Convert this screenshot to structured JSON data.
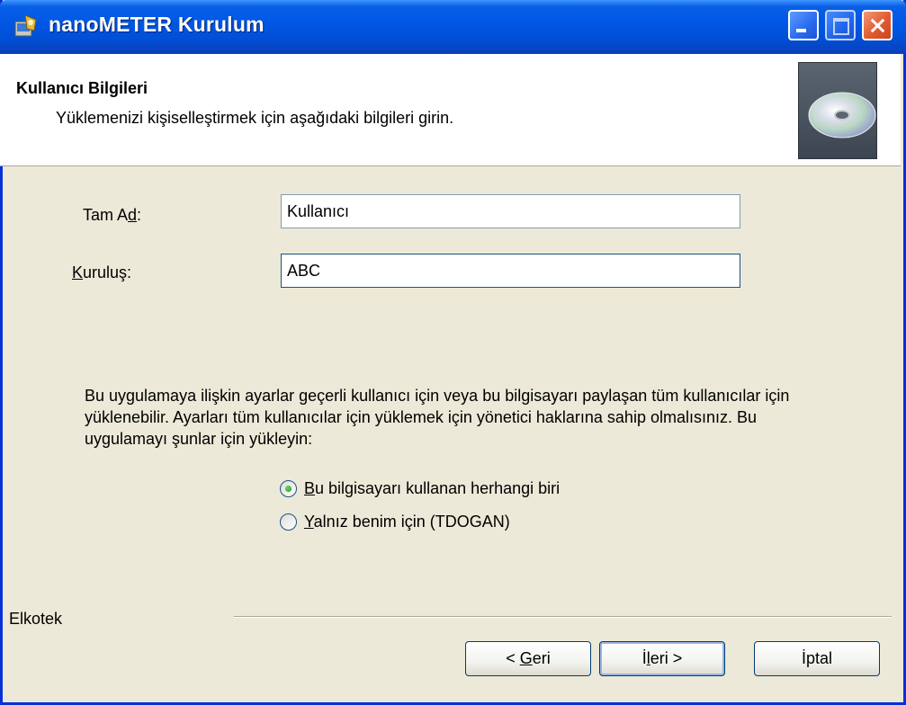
{
  "window": {
    "title": "nanoMETER Kurulum"
  },
  "banner": {
    "title": "Kullanıcı Bilgileri",
    "subtitle": "Yüklemenizi kişiselleştirmek için aşağıdaki bilgileri girin."
  },
  "form": {
    "full_name_label_pre": "Tam A",
    "full_name_label_key": "d",
    "full_name_label_post": ":",
    "full_name_value": "Kullanıcı",
    "org_label_key": "K",
    "org_label_post": "uruluş:",
    "org_value": "ABC"
  },
  "description": "Bu uygulamaya ilişkin ayarlar geçerli kullanıcı için veya bu bilgisayarı paylaşan tüm kullanıcılar için yüklenebilir. Ayarları tüm kullanıcılar için yüklemek için yönetici haklarına sahip olmalısınız. Bu uygulamayı şunlar için yükleyin:",
  "options": [
    {
      "key": "B",
      "rest": "u bilgisayarı kullanan herhangi biri",
      "checked": true
    },
    {
      "key": "Y",
      "rest": "alnız benim için (TDOGAN)",
      "checked": false
    }
  ],
  "footer": {
    "brand": "Elkotek",
    "back_pre": "< ",
    "back_key": "G",
    "back_post": "eri",
    "next_pre": "İ",
    "next_key": "l",
    "next_post": "eri >",
    "cancel": "İptal"
  },
  "icons": {
    "app": "installer-icon",
    "banner": "cd-disc-icon"
  }
}
